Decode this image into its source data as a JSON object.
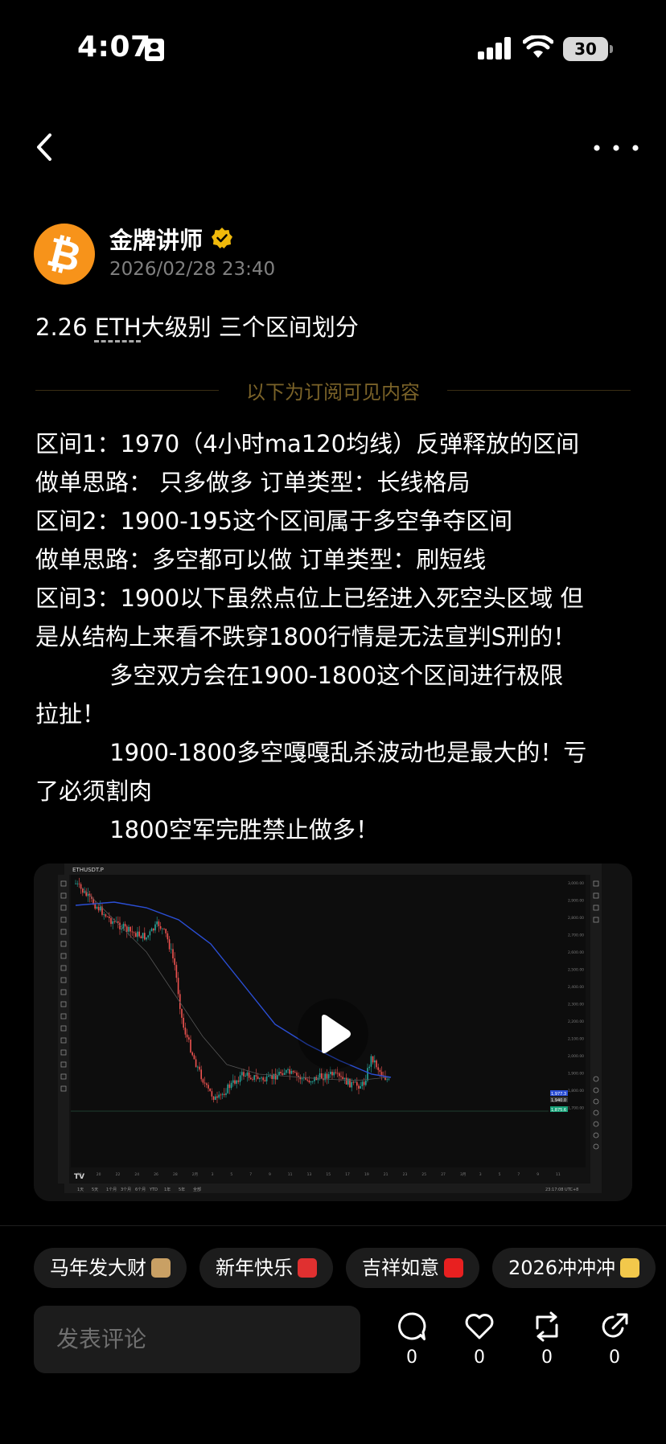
{
  "status_bar": {
    "time": "4:07",
    "battery": "30"
  },
  "author": {
    "name": "金牌讲师",
    "time": "2026/02/28 23:40",
    "avatar_symbol": "₿"
  },
  "post": {
    "title_prefix": "2.26 ",
    "title_eth": "ETH",
    "title_suffix": "大级别 三个区间划分",
    "divider_text": "以下为订阅可见内容",
    "lines": [
      "区间1：1970（4小时ma120均线）反弹释放的区间",
      "做单思路： 只多做多 订单类型：长线格局",
      "区间2：1900-195这个区间属于多空争夺区间",
      "做单思路：多空都可以做 订单类型：刷短线",
      "区间3：1900以下虽然点位上已经进入死空头区域 但",
      "是从结构上来看不跌穿1800行情是无法宣判S刑的！",
      "          多空双方会在1900-1800这个区间进行极限",
      "拉扯！",
      "          1900-1800多空嘎嘎乱杀波动也是最大的！亏",
      "了必须割肉",
      "          1800空军完胜禁止做多！"
    ]
  },
  "video": {
    "symbol": "ETHUSDT.P",
    "y_ticks": [
      "3,000.00",
      "2,900.00",
      "2,800.00",
      "2,700.00",
      "2,600.00",
      "2,500.00",
      "2,400.00",
      "2,300.00",
      "2,200.00",
      "2,100.00",
      "2,000.00",
      "1,900.00",
      "1,800.00",
      "1,700.00"
    ],
    "x_ticks": [
      "18",
      "20",
      "22",
      "24",
      "26",
      "28",
      "2月",
      "3",
      "5",
      "7",
      "9",
      "11",
      "13",
      "15",
      "17",
      "19",
      "21",
      "23",
      "25",
      "27",
      "3月",
      "3",
      "5",
      "7",
      "9",
      "11"
    ],
    "price_tag_1": "1,977.3",
    "price_tag_2": "1,940.0",
    "price_tag_3": "1,875.6",
    "bottom_time": "23:17:08 UTC+8",
    "bottom_ranges": [
      "1天",
      "5天",
      "1个月",
      "3个月",
      "6个月",
      "YTD",
      "1年",
      "5年",
      "全部"
    ]
  },
  "tags": [
    {
      "label": "马年发大财",
      "emoji_color": "#c9a064"
    },
    {
      "label": "新年快乐",
      "emoji_color": "#e03030"
    },
    {
      "label": "吉祥如意",
      "emoji_color": "#e82020"
    },
    {
      "label": "2026冲冲冲",
      "emoji_color": "#f2c84b"
    }
  ],
  "comment": {
    "placeholder": "发表评论"
  },
  "actions": {
    "comments": "0",
    "likes": "0",
    "reposts": "0",
    "shares": "0"
  }
}
